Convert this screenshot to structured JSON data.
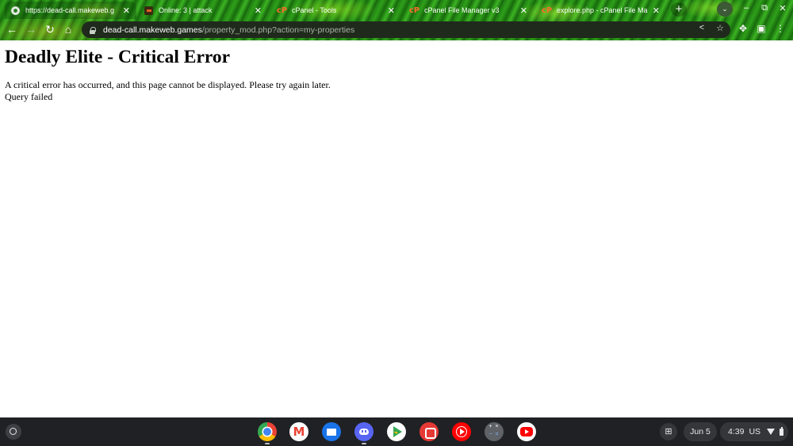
{
  "browser": {
    "tabs": [
      {
        "title": "https://dead-call.makeweb.g",
        "favicon": "globe-icon",
        "active": true
      },
      {
        "title": "Online: 3 | attack",
        "favicon": "game-favicon-icon",
        "active": false
      },
      {
        "title": "cPanel - Tools",
        "favicon": "cpanel-icon",
        "active": false
      },
      {
        "title": "cPanel File Manager v3",
        "favicon": "cpanel-icon",
        "active": false
      },
      {
        "title": "explore.php - cPanel File Mana",
        "favicon": "cpanel-icon",
        "active": false
      }
    ],
    "new_tab_glyph": "+",
    "tab_search_glyph": "⌄",
    "window_controls": {
      "minimize": "–",
      "restore": "⧉",
      "close": "✕"
    },
    "nav": {
      "back": "←",
      "forward": "→",
      "reload": "↻",
      "home": "⌂"
    },
    "url": {
      "host": "dead-call.makeweb.games",
      "path": "/property_mod.php?action=my-properties"
    },
    "omnibox_icons": {
      "share": "share-icon",
      "bookmark": "star-icon"
    },
    "toolbar_icons": {
      "extensions": "puzzle-icon",
      "side_panel": "side-panel-icon",
      "menu": "more-vert-icon"
    },
    "theme_colors": {
      "frame": "#1f7d12",
      "omnibox": "#1f2a1c",
      "url_host": "#ffffff",
      "url_path": "#a9b3a6"
    }
  },
  "page": {
    "title": "Deadly Elite - Critical Error",
    "message": "A critical error has occurred, and this page cannot be displayed. Please try again later.",
    "detail": "Query failed"
  },
  "shelf": {
    "apps": [
      {
        "name": "chrome-icon",
        "running": true
      },
      {
        "name": "gmail-icon",
        "running": false
      },
      {
        "name": "files-icon",
        "running": false
      },
      {
        "name": "discord-icon",
        "running": true
      },
      {
        "name": "play-store-icon",
        "running": false
      },
      {
        "name": "red-app-icon",
        "running": false
      },
      {
        "name": "youtube-music-icon",
        "running": false
      },
      {
        "name": "calculator-icon",
        "running": false
      },
      {
        "name": "youtube-icon",
        "running": false
      }
    ],
    "date": "Jun 5",
    "time": "4:39",
    "ime": "US",
    "colors": {
      "shelf": "#202124",
      "pill": "#35363a"
    }
  }
}
